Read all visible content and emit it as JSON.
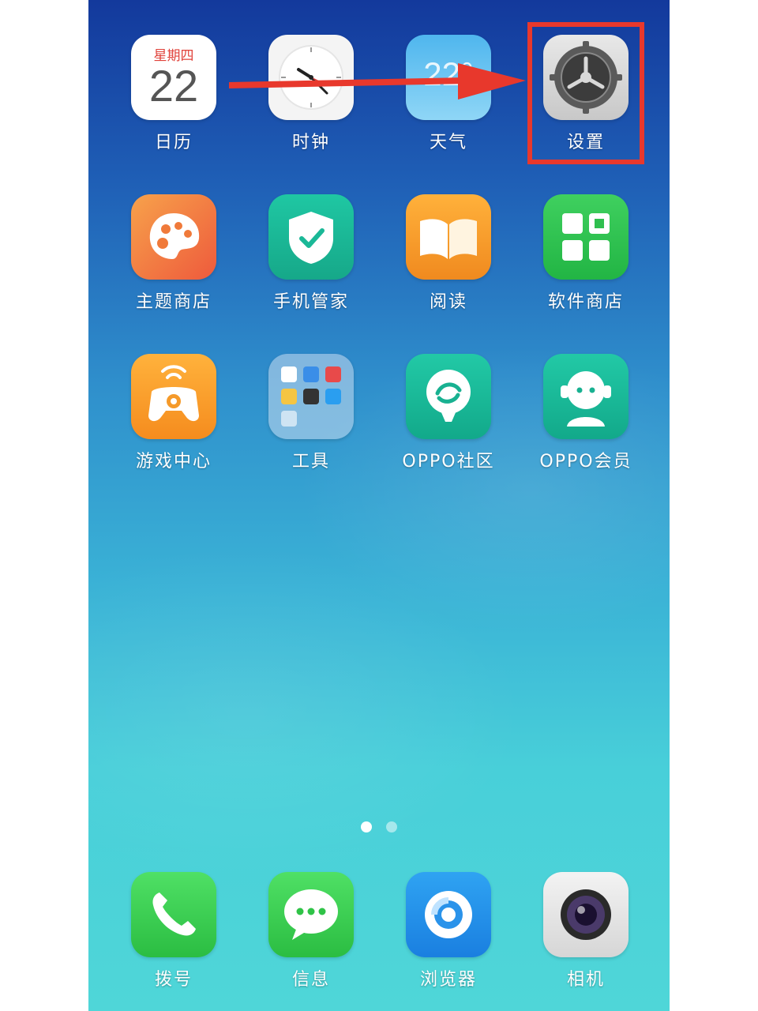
{
  "apps_row1": [
    {
      "label": "日历",
      "weekday": "星期四",
      "day": "22"
    },
    {
      "label": "时钟"
    },
    {
      "label": "天气",
      "temp": "22°"
    },
    {
      "label": "设置"
    }
  ],
  "apps_row2": [
    {
      "label": "主题商店"
    },
    {
      "label": "手机管家"
    },
    {
      "label": "阅读"
    },
    {
      "label": "软件商店"
    }
  ],
  "apps_row3": [
    {
      "label": "游戏中心"
    },
    {
      "label": "工具"
    },
    {
      "label": "OPPO社区"
    },
    {
      "label": "OPPO会员"
    }
  ],
  "dock": [
    {
      "label": "拨号"
    },
    {
      "label": "信息"
    },
    {
      "label": "浏览器"
    },
    {
      "label": "相机"
    }
  ],
  "page_indicator": {
    "count": 2,
    "active_index": 0
  },
  "annotation": {
    "highlight_color": "#e8382c",
    "target": "设置"
  }
}
